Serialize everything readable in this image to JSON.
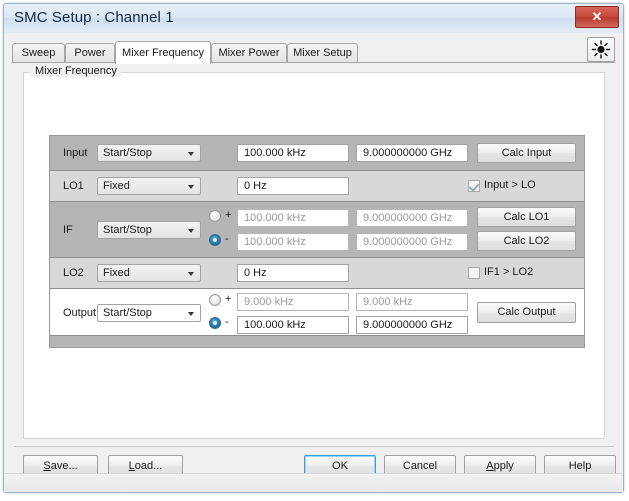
{
  "window": {
    "title": "SMC Setup : Channel 1",
    "close_label": "✕",
    "accent_blue": "#3c9ddb",
    "close_red": "#c8483c"
  },
  "toolbar": {
    "sun_icon": "brightness-icon"
  },
  "tabs": [
    {
      "label": "Sweep",
      "active": false
    },
    {
      "label": "Power",
      "active": false
    },
    {
      "label": "Mixer Frequency",
      "active": true
    },
    {
      "label": "Mixer Power",
      "active": false
    },
    {
      "label": "Mixer Setup",
      "active": false
    }
  ],
  "group": {
    "label": "Mixer Frequency"
  },
  "rows": {
    "input": {
      "label": "Input",
      "mode": "Start/Stop",
      "start": "100.000 kHz",
      "stop": "9.000000000 GHz",
      "button": "Calc Input"
    },
    "lo1": {
      "label": "LO1",
      "mode": "Fixed",
      "value": "0 Hz",
      "checkbox_label": "Input > LO",
      "checked": true
    },
    "if": {
      "label": "IF",
      "mode": "Start/Stop",
      "plus_label": "+",
      "minus_label": "-",
      "selected": "minus",
      "plus_start": "100.000 kHz",
      "plus_stop": "9.000000000 GHz",
      "minus_start": "100.000 kHz",
      "minus_stop": "9.000000000 GHz",
      "button_lo1": "Calc LO1",
      "button_lo2": "Calc LO2"
    },
    "lo2": {
      "label": "LO2",
      "mode": "Fixed",
      "value": "0 Hz",
      "checkbox_label": "IF1 > LO2",
      "checked": false
    },
    "output": {
      "label": "Output",
      "mode": "Start/Stop",
      "plus_label": "+",
      "minus_label": "-",
      "selected": "minus",
      "plus_start": "9.000 kHz",
      "plus_stop": "9.000 kHz",
      "minus_start": "100.000 kHz",
      "minus_stop": "9.000000000 GHz",
      "button": "Calc Output"
    }
  },
  "footer": {
    "save": "Save...",
    "load": "Load...",
    "ok": "OK",
    "cancel": "Cancel",
    "apply": "Apply",
    "help": "Help"
  }
}
